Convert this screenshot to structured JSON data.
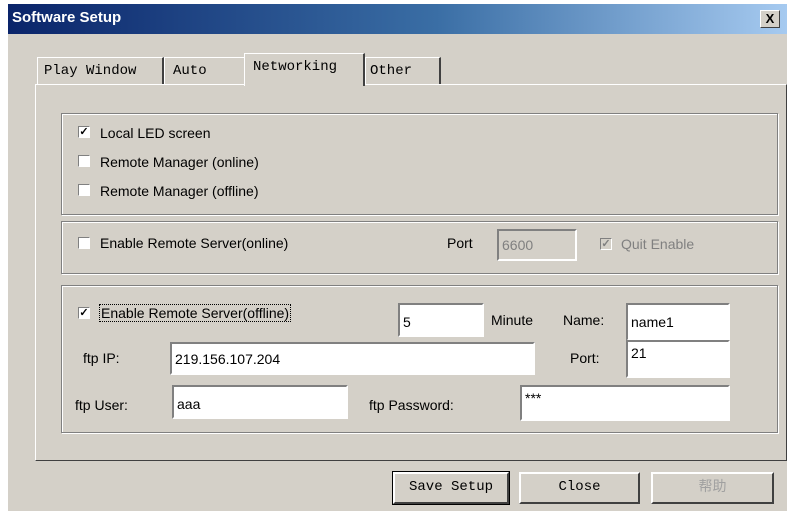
{
  "window": {
    "title": "Software Setup",
    "close_label": "X"
  },
  "tabs": [
    {
      "label": "Play Window"
    },
    {
      "label": "Auto"
    },
    {
      "label": "Networking"
    },
    {
      "label": "Other"
    }
  ],
  "local_group": {
    "local_led": {
      "label": "Local LED screen",
      "checked": true
    },
    "remote_online": {
      "label": "Remote Manager (online)",
      "checked": false
    },
    "remote_offline": {
      "label": "Remote Manager (offline)",
      "checked": false
    }
  },
  "server_online": {
    "enable_label": "Enable Remote Server(online)",
    "port_label": "Port",
    "port_value": "6600",
    "quit_enable_label": "Quit Enable",
    "quit_enable_checked": true
  },
  "server_offline": {
    "enable_label": "Enable Remote Server(offline)",
    "enable_checked": true,
    "minute_value": "5",
    "minute_label": "Minute",
    "name_label": "Name:",
    "name_value": "name1",
    "ftp_ip_label": "ftp IP:",
    "ftp_ip_value": "219.156.107.204",
    "port_label": "Port:",
    "port_value": "21",
    "ftp_user_label": "ftp User:",
    "ftp_user_value": "aaa",
    "ftp_password_label": "ftp Password:",
    "ftp_password_value": "***"
  },
  "buttons": {
    "save": "Save Setup",
    "close": "Close",
    "help": "帮助"
  }
}
